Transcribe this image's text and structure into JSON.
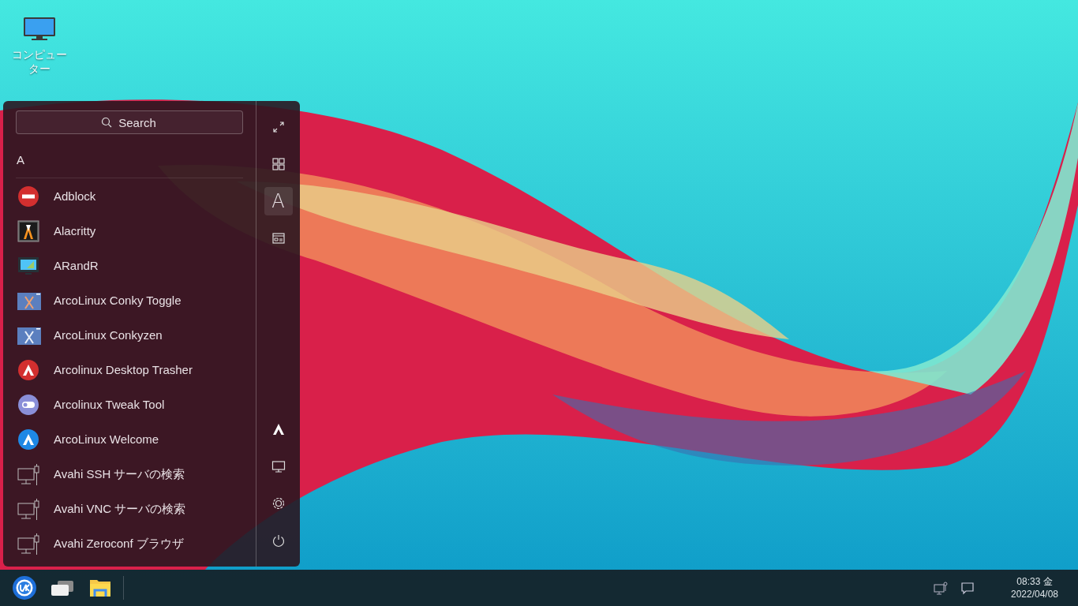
{
  "desktop_icons": [
    {
      "label": "コンピューター",
      "kind": "computer"
    }
  ],
  "menu": {
    "search": {
      "placeholder": "Search"
    },
    "section": "A",
    "apps": [
      {
        "name": "Adblock",
        "kind": "stop"
      },
      {
        "name": "Alacritty",
        "kind": "terminal-a"
      },
      {
        "name": "ARandR",
        "kind": "monitor"
      },
      {
        "name": "ArcoLinux Conky Toggle",
        "kind": "x-window-orange"
      },
      {
        "name": "ArcoLinux Conkyzen",
        "kind": "x-window"
      },
      {
        "name": "Arcolinux Desktop Trasher",
        "kind": "arco-red"
      },
      {
        "name": "Arcolinux Tweak Tool",
        "kind": "toggle"
      },
      {
        "name": "ArcoLinux Welcome",
        "kind": "arco-blue"
      },
      {
        "name": "Avahi SSH サーバの検索",
        "kind": "network"
      },
      {
        "name": "Avahi VNC サーバの検索",
        "kind": "network"
      },
      {
        "name": "Avahi Zeroconf ブラウザ",
        "kind": "network"
      }
    ],
    "sidebar_top": [
      {
        "kind": "expand",
        "selected": false
      },
      {
        "kind": "grid",
        "selected": false
      },
      {
        "kind": "alpha",
        "label": "A",
        "selected": true
      },
      {
        "kind": "list",
        "selected": false
      }
    ],
    "sidebar_bottom": [
      {
        "kind": "arco"
      },
      {
        "kind": "display"
      },
      {
        "kind": "settings"
      },
      {
        "kind": "power"
      }
    ]
  },
  "taskbar": {
    "launchers": [
      {
        "kind": "start"
      },
      {
        "kind": "windows"
      },
      {
        "kind": "files"
      }
    ],
    "tray": [
      {
        "kind": "network"
      },
      {
        "kind": "notifications"
      }
    ],
    "clock": {
      "time": "08:33 金",
      "date": "2022/04/08"
    }
  }
}
